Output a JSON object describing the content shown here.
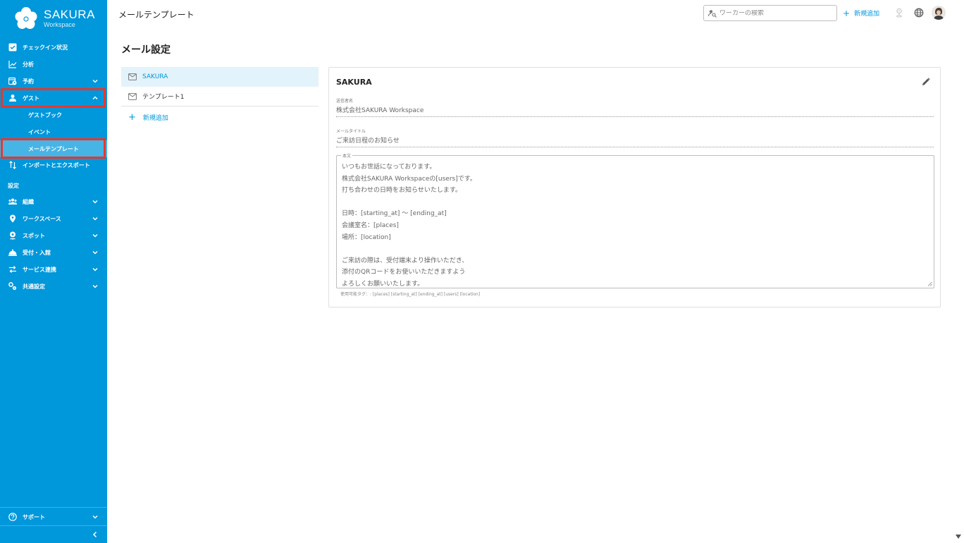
{
  "app": {
    "brand": "SAKURA",
    "brand_sub": "Workspace"
  },
  "sidebar": {
    "items": [
      {
        "label": "チェックイン状況",
        "icon": "checkbox-icon",
        "chevron": false
      },
      {
        "label": "分析",
        "icon": "chart-line-icon",
        "chevron": false
      },
      {
        "label": "予約",
        "icon": "calendar-clock-icon",
        "chevron": true
      },
      {
        "label": "ゲスト",
        "icon": "person-icon",
        "chevron": true,
        "expanded": true
      }
    ],
    "guest_sub": [
      {
        "label": "ゲストブック"
      },
      {
        "label": "イベント"
      },
      {
        "label": "メールテンプレート",
        "active": true
      }
    ],
    "import_export": {
      "label": "インポートとエクスポート",
      "icon": "import-export-icon"
    },
    "settings_label": "設定",
    "settings_items": [
      {
        "label": "組織",
        "icon": "people-icon"
      },
      {
        "label": "ワークスペース",
        "icon": "location-pin-icon"
      },
      {
        "label": "スポット",
        "icon": "person-pin-icon"
      },
      {
        "label": "受付・入館",
        "icon": "bell-icon"
      },
      {
        "label": "サービス連携",
        "icon": "sync-icon"
      },
      {
        "label": "共通設定",
        "icon": "gears-icon"
      }
    ],
    "support": {
      "label": "サポート",
      "icon": "help-circle-icon"
    }
  },
  "header": {
    "title": "メールテンプレート",
    "search_placeholder": "ワーカーの検索",
    "add_new": "新規追加"
  },
  "page": {
    "title": "メール設定"
  },
  "templates": {
    "items": [
      {
        "label": "SAKURA",
        "active": true
      },
      {
        "label": "テンプレート1",
        "active": false
      }
    ],
    "add_label": "新規追加"
  },
  "detail": {
    "title": "SAKURA",
    "sender_label": "送信者名",
    "sender_value": "株式会社SAKURA Workspace",
    "subject_label": "メールタイトル",
    "subject_value": "ご来訪日程のお知らせ",
    "body_label": "本文",
    "body_value": "いつもお世話になっております。\n株式会社SAKURA Workspaceの[users]です。\n打ち合わせの日時をお知らせいたします。\n\n日時：[starting_at] 〜 [ending_at]\n会議室名：[places]\n場所：[location]\n\nご来訪の際は、受付端末より操作いただき、\n添付のQRコードをお使いいただきますよう\nよろしくお願いいたします。",
    "tags_hint": "使用可能タグ：: [places] [starting_at] [ending_at] [users] [location]"
  },
  "colors": {
    "sidebar_bg": "#0097db",
    "accent": "#0097db",
    "highlight": "#e8372c",
    "active_row": "#e3f3fb"
  }
}
